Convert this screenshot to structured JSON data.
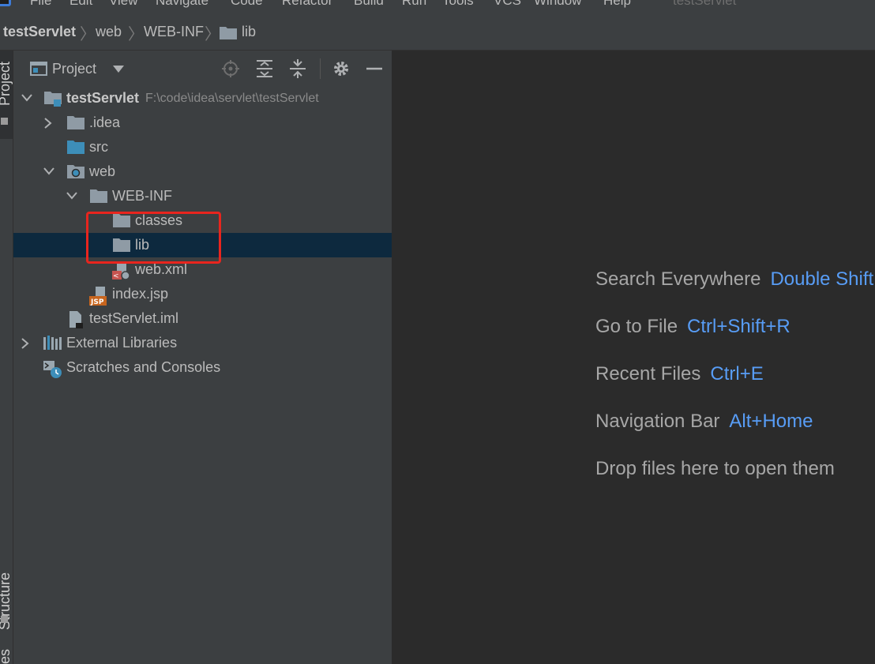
{
  "menu": {
    "items": [
      "File",
      "Edit",
      "View",
      "Navigate",
      "Code",
      "Refactor",
      "Build",
      "Run",
      "Tools",
      "VCS",
      "Window",
      "Help"
    ],
    "window_title": "testServlet"
  },
  "breadcrumb": {
    "project": "testServlet",
    "items": [
      "web",
      "WEB-INF",
      "lib"
    ]
  },
  "left_strip": {
    "project_tab": "Project",
    "structure_tab": "Structure",
    "favorites_tab": "es"
  },
  "project_panel": {
    "title": "Project",
    "tree": {
      "root": {
        "label": "testServlet",
        "path": "F:\\code\\idea\\servlet\\testServlet"
      },
      "idea": ".idea",
      "src": "src",
      "web": "web",
      "webinf": "WEB-INF",
      "classes": "classes",
      "lib": "lib",
      "webxml": "web.xml",
      "indexjsp": "index.jsp",
      "iml": "testServlet.iml",
      "external": "External Libraries",
      "scratches": "Scratches and Consoles"
    }
  },
  "editor_hints": [
    {
      "label": "Search Everywhere",
      "key": "Double Shift"
    },
    {
      "label": "Go to File",
      "key": "Ctrl+Shift+R"
    },
    {
      "label": "Recent Files",
      "key": "Ctrl+E"
    },
    {
      "label": "Navigation Bar",
      "key": "Alt+Home"
    },
    {
      "label": "Drop files here to open them",
      "key": ""
    }
  ],
  "colors": {
    "accent_link": "#589df6",
    "selection": "#0d293e",
    "highlight_border": "#e8251e",
    "folder": "#8f9ba5",
    "source_folder": "#3d8eb9"
  }
}
